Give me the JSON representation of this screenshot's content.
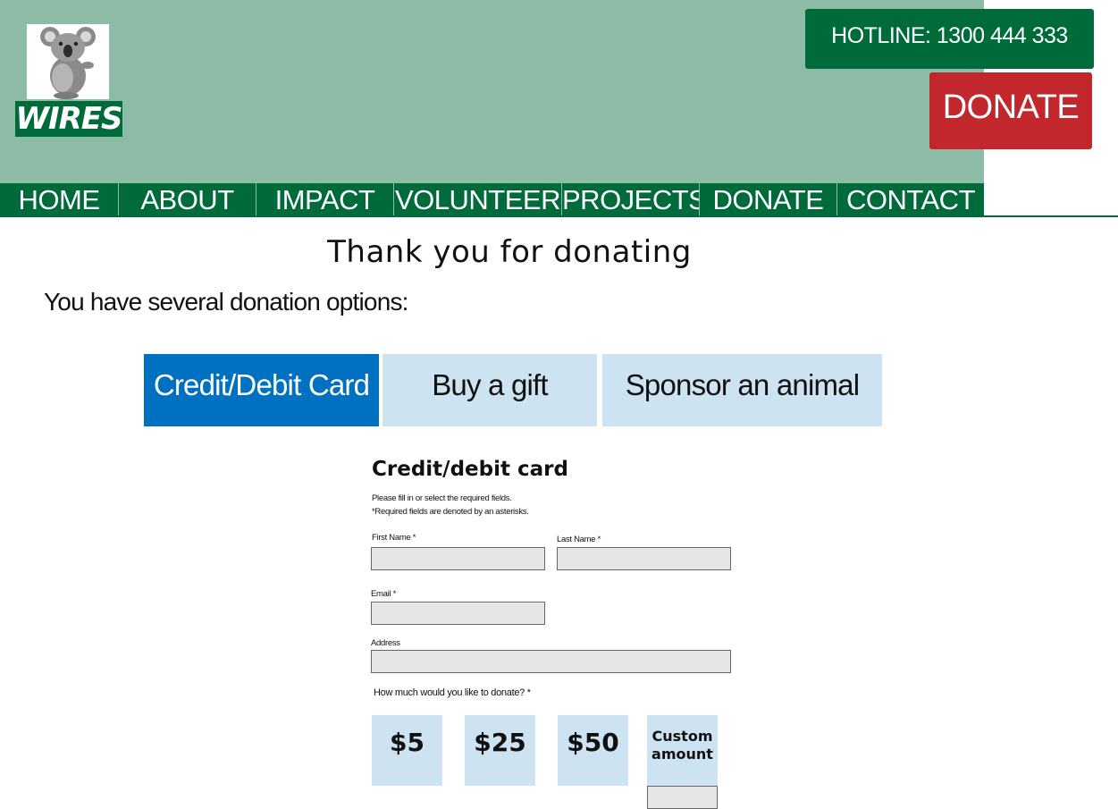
{
  "header": {
    "logo_text": "WIRES",
    "hotline_label": "HOTLINE: 1300 444 333",
    "donate_label": "DONATE"
  },
  "nav": {
    "items": [
      {
        "label": "HOME"
      },
      {
        "label": "ABOUT"
      },
      {
        "label": "IMPACT"
      },
      {
        "label": "VOLUNTEER"
      },
      {
        "label": "PROJECTS"
      },
      {
        "label": "DONATE"
      },
      {
        "label": "CONTACT"
      }
    ]
  },
  "main": {
    "title": "Thank you for donating",
    "intro": "You have several donation options:",
    "tabs": [
      {
        "label": "Credit/Debit Card",
        "active": true
      },
      {
        "label": "Buy a gift",
        "active": false
      },
      {
        "label": "Sponsor an animal",
        "active": false
      }
    ]
  },
  "form": {
    "title": "Credit/debit card",
    "note1": "Please fill in or select the required fields.",
    "note2": "*Required fields are denoted by an asterisks.",
    "first_name_label": "First Name *",
    "last_name_label": "Last Name *",
    "email_label": "Email *",
    "address_label": "Address",
    "amount_question": "How much would you like to donate? *",
    "amounts": [
      {
        "label": "$5"
      },
      {
        "label": "$25"
      },
      {
        "label": "$50"
      },
      {
        "label": "Custom amount"
      }
    ]
  },
  "colors": {
    "header_bg": "#8dbca6",
    "brand_green": "#006b3a",
    "donate_red": "#c1272d",
    "tab_active": "#0070c0",
    "tab_inactive": "#cde3f2",
    "field_bg": "#e6e6e6"
  },
  "icons": {
    "logo": "koala-icon"
  }
}
